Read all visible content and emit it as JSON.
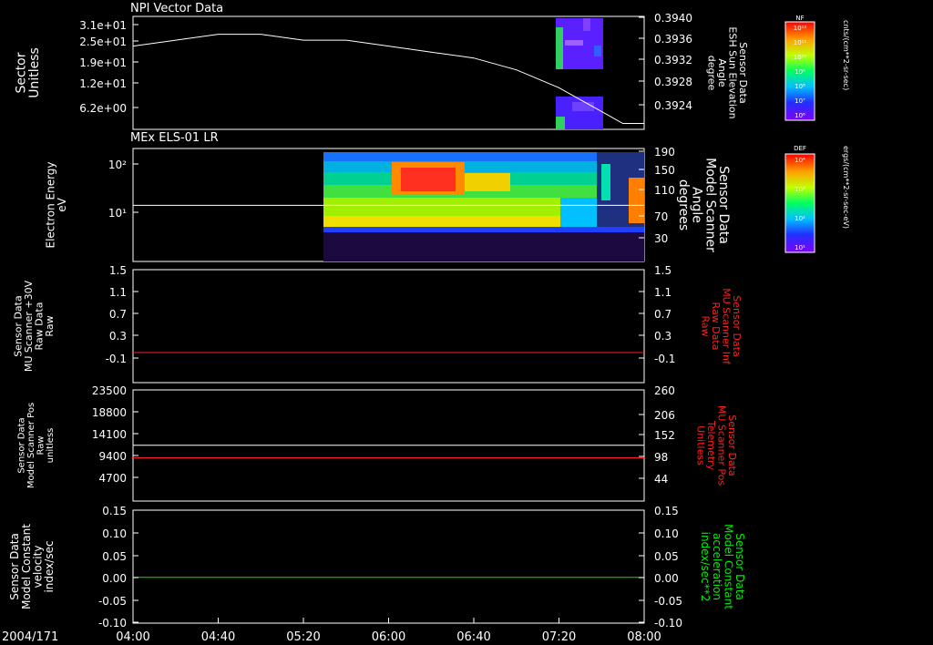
{
  "date_label": "2004/171",
  "x_ticks": [
    "04:00",
    "04:40",
    "05:20",
    "06:00",
    "06:40",
    "07:20",
    "08:00"
  ],
  "panels": [
    {
      "title": "NPI Vector Data",
      "left_label": [
        "Sector",
        "Unitless"
      ],
      "left_ticks": [
        "3.1e+01",
        "2.5e+01",
        "1.9e+01",
        "1.2e+01",
        "6.2e+00"
      ],
      "right_label": [
        "Sensor Data",
        "ESH Sun Elevation",
        "Angle",
        "degree"
      ],
      "right_label_color": "#ffffff",
      "right_ticks": [
        "0.3940",
        "0.3936",
        "0.3932",
        "0.3928",
        "0.3924"
      ],
      "colorbar": {
        "title": "NF",
        "unit": "cnts/(cm**2-sr-sec)",
        "ticks": [
          "10¹²",
          "10¹¹",
          "10¹⁰",
          "10⁹",
          "10⁸",
          "10⁷",
          "10⁶"
        ]
      }
    },
    {
      "title": "MEx ELS-01 LR",
      "left_label": [
        "Electron Energy",
        "eV"
      ],
      "left_ticks": [
        "10²",
        "10¹"
      ],
      "right_label": [
        "Sensor Data",
        "Model Scanner",
        "Angle",
        "degrees"
      ],
      "right_label_color": "#ffffff",
      "right_ticks": [
        "190",
        "150",
        "110",
        "70",
        "30"
      ],
      "colorbar": {
        "title": "DEF",
        "unit": "ergs/(cm**2-sr-sec-eV)",
        "ticks": [
          "10⁴",
          "10³",
          "10²",
          "10¹"
        ]
      }
    },
    {
      "left_label": [
        "Sensor Data",
        "MU Scanner +30V",
        "Raw Data",
        "Raw"
      ],
      "left_ticks": [
        "1.5",
        "1.1",
        "0.7",
        "0.3",
        "-0.1"
      ],
      "right_label": [
        "Sensor Data",
        "MU Scanner Inf",
        "Raw Data",
        "Raw"
      ],
      "right_label_color": "#ff2020",
      "right_ticks": [
        "1.5",
        "1.1",
        "0.7",
        "0.3",
        "-0.1"
      ]
    },
    {
      "left_label": [
        "Sensor Data",
        "Model Scanner Pos",
        "Raw",
        "unitless"
      ],
      "left_ticks": [
        "23500",
        "18800",
        "14100",
        "9400",
        "4700"
      ],
      "right_label": [
        "Sensor Data",
        "MU Scanner Pos",
        "Telemetry",
        "Unitless"
      ],
      "right_label_color": "#ff2020",
      "right_ticks": [
        "260",
        "206",
        "152",
        "98",
        "44"
      ]
    },
    {
      "left_label": [
        "Sensor Data",
        "Model Constant",
        "velocity",
        "index/sec"
      ],
      "left_ticks": [
        "0.15",
        "0.10",
        "0.05",
        "0.00",
        "-0.05",
        "-0.10"
      ],
      "right_label": [
        "Sensor Data",
        "Model Constant",
        "acceleration",
        "index/sec**2"
      ],
      "right_label_color": "#00ee00",
      "right_ticks": [
        "0.15",
        "0.10",
        "0.05",
        "0.00",
        "-0.05",
        "-0.10"
      ]
    }
  ],
  "colors": {
    "background": "#000000",
    "axis": "#ffffff",
    "red_trace": "#ff2020",
    "green_trace": "#00ee00"
  },
  "chart_data": [
    {
      "type": "line",
      "title": "NPI Vector Data",
      "x_range": [
        "04:00",
        "08:00"
      ],
      "y_right_range": [
        0.3921,
        0.394
      ],
      "series": [
        {
          "name": "ESH Sun Elevation Angle",
          "x": [
            "04:00",
            "04:20",
            "04:40",
            "05:00",
            "05:20",
            "05:40",
            "06:00",
            "06:20",
            "06:40",
            "07:00",
            "07:20",
            "07:30",
            "07:40",
            "07:50",
            "08:00"
          ],
          "values": [
            0.3935,
            0.3936,
            0.3937,
            0.3937,
            0.3936,
            0.3936,
            0.3935,
            0.3934,
            0.3933,
            0.3931,
            0.3928,
            0.3926,
            0.3924,
            0.3922,
            0.3922
          ]
        }
      ]
    },
    {
      "type": "heatmap",
      "title": "MEx ELS-01 LR",
      "x_range": [
        "04:00",
        "08:00"
      ],
      "y_scale": "log",
      "y_right_range": [
        10,
        190
      ],
      "series": [
        {
          "name": "Model Scanner Angle",
          "x": [
            "04:00",
            "05:24",
            "08:00"
          ],
          "values": [
            90,
            90,
            90
          ]
        }
      ]
    },
    {
      "type": "line",
      "x_range": [
        "04:00",
        "08:00"
      ],
      "y_range": [
        -0.3,
        1.5
      ],
      "series": [
        {
          "name": "MU Scanner Inf Raw Data",
          "x": [
            "04:00",
            "08:00"
          ],
          "values": [
            -0.0,
            -0.0
          ],
          "color": "#ff2020"
        }
      ]
    },
    {
      "type": "line",
      "x_range": [
        "04:00",
        "08:00"
      ],
      "y_range": [
        0,
        23500
      ],
      "series": [
        {
          "name": "Model Scanner Pos",
          "x": [
            "04:00",
            "08:00"
          ],
          "values": [
            11600,
            11600
          ],
          "color": "#ffffff"
        },
        {
          "name": "MU Scanner Pos Telemetry",
          "x": [
            "04:00",
            "08:00"
          ],
          "values": [
            8900,
            8900
          ],
          "color": "#ff2020"
        }
      ]
    },
    {
      "type": "line",
      "x_range": [
        "04:00",
        "08:00"
      ],
      "y_range": [
        -0.1,
        0.15
      ],
      "series": [
        {
          "name": "Model Constant velocity",
          "x": [
            "04:00",
            "08:00"
          ],
          "values": [
            0.0,
            0.0
          ],
          "color": "#00ee00"
        }
      ]
    }
  ]
}
